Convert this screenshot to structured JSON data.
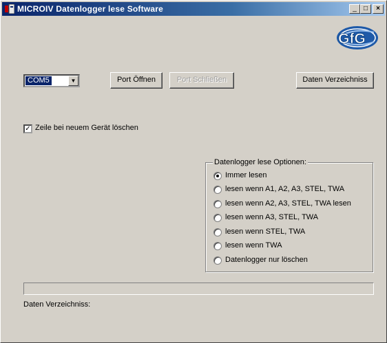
{
  "window": {
    "title": "MICROIV Datenlogger lese Software",
    "logo_text": "GfG",
    "controls": {
      "minimize": "_",
      "maximize": "□",
      "close": "×"
    }
  },
  "toolbar": {
    "port_select": {
      "value": "COM5"
    },
    "open_port_label": "Port Öffnen",
    "close_port_label": "Port Schließen",
    "data_dir_button_label": "Daten Verzeichniss"
  },
  "options": {
    "clear_row_checkbox": {
      "label": "Zeile bei neuem Gerät löschen",
      "checked": true
    }
  },
  "read_options": {
    "title": "Datenlogger lese Optionen:",
    "items": [
      {
        "label": "Immer lesen",
        "selected": true
      },
      {
        "label": "lesen wenn A1, A2, A3, STEL, TWA",
        "selected": false
      },
      {
        "label": "lesen wenn A2, A3, STEL, TWA lesen",
        "selected": false
      },
      {
        "label": "lesen wenn A3, STEL, TWA",
        "selected": false
      },
      {
        "label": "lesen wenn STEL, TWA",
        "selected": false
      },
      {
        "label": "lesen wenn TWA",
        "selected": false
      },
      {
        "label": "Datenlogger nur löschen",
        "selected": false
      }
    ]
  },
  "progress": {
    "value": 0
  },
  "status": {
    "data_dir_label": "Daten Verzeichniss:"
  },
  "colors": {
    "face": "#d4d0c8",
    "titlebar_start": "#0a246a",
    "titlebar_end": "#a6caf0",
    "logo_blue": "#1f5aa8"
  }
}
